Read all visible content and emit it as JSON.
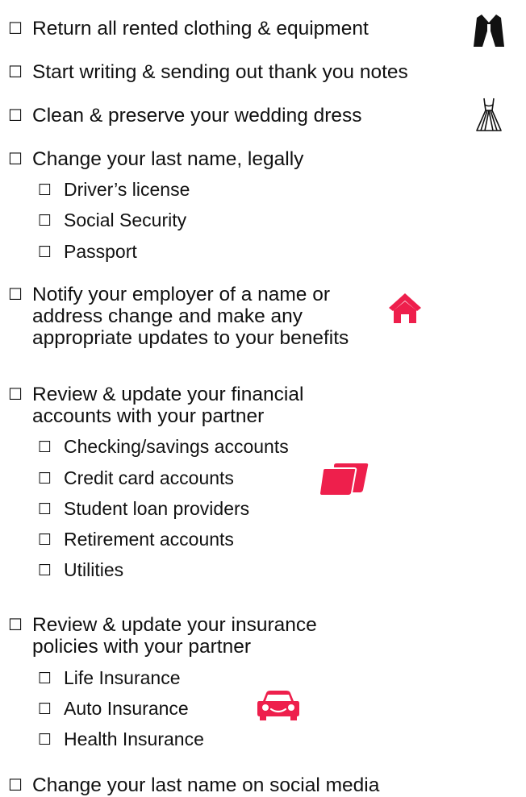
{
  "checkbox_glyph": "☐",
  "accent_color": "#ee1f4c",
  "icons": {
    "suit": "suit-jacket-icon",
    "dress": "wedding-dress-icon",
    "home": "house-icon",
    "cards": "credit-cards-icon",
    "car": "car-icon"
  },
  "checklist": {
    "return_rentals": "Return all rented clothing & equipment",
    "thank_you_notes": "Start writing & sending out thank you notes",
    "wedding_dress": "Clean & preserve your wedding dress",
    "name_change": "Change your last name, legally",
    "name_change_items": [
      "Driver’s license",
      "Social Security",
      "Passport"
    ],
    "employer_notify": [
      "Notify your employer of a name or",
      "address change and make any",
      "appropriate updates to your benefits"
    ],
    "financial_review": [
      "Review & update your financial",
      "accounts with your partner"
    ],
    "financial_items": [
      "Checking/savings accounts",
      "Credit card accounts",
      "Student loan providers",
      "Retirement accounts",
      "Utilities"
    ],
    "insurance_review": [
      "Review & update your insurance",
      "policies with your partner"
    ],
    "insurance_items": [
      "Life Insurance",
      "Auto Insurance",
      "Health Insurance"
    ],
    "social_media": "Change your last name on social media"
  }
}
